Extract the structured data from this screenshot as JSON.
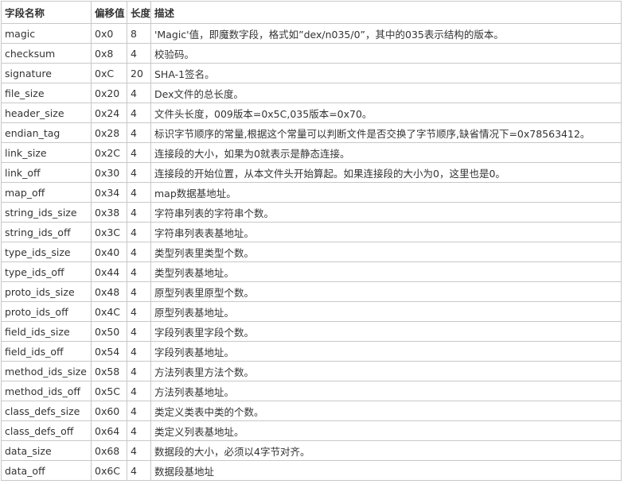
{
  "table": {
    "headers": [
      "字段名称",
      "偏移值",
      "长度",
      "描述"
    ],
    "rows": [
      [
        "magic",
        "0x0",
        "8",
        "'Magic'值，即魔数字段，格式如”dex/n035/0”，其中的035表示结构的版本。"
      ],
      [
        "checksum",
        "0x8",
        "4",
        "校验码。"
      ],
      [
        "signature",
        "0xC",
        "20",
        "SHA-1签名。"
      ],
      [
        "file_size",
        "0x20",
        "4",
        "Dex文件的总长度。"
      ],
      [
        "header_size",
        "0x24",
        "4",
        "文件头长度，009版本=0x5C,035版本=0x70。"
      ],
      [
        "endian_tag",
        "0x28",
        "4",
        "标识字节顺序的常量,根据这个常量可以判断文件是否交换了字节顺序,缺省情况下=0x78563412。"
      ],
      [
        "link_size",
        "0x2C",
        "4",
        "连接段的大小，如果为0就表示是静态连接。"
      ],
      [
        "link_off",
        "0x30",
        "4",
        "连接段的开始位置，从本文件头开始算起。如果连接段的大小为0，这里也是0。"
      ],
      [
        "map_off",
        "0x34",
        "4",
        "map数据基地址。"
      ],
      [
        "string_ids_size",
        "0x38",
        "4",
        "字符串列表的字符串个数。"
      ],
      [
        "string_ids_off",
        "0x3C",
        "4",
        "字符串列表表基地址。"
      ],
      [
        "type_ids_size",
        "0x40",
        "4",
        "类型列表里类型个数。"
      ],
      [
        "type_ids_off",
        "0x44",
        "4",
        "类型列表基地址。"
      ],
      [
        "proto_ids_size",
        "0x48",
        "4",
        "原型列表里原型个数。"
      ],
      [
        "proto_ids_off",
        "0x4C",
        "4",
        "原型列表基地址。"
      ],
      [
        "field_ids_size",
        "0x50",
        "4",
        "字段列表里字段个数。"
      ],
      [
        "field_ids_off",
        "0x54",
        "4",
        "字段列表基地址。"
      ],
      [
        "method_ids_size",
        "0x58",
        "4",
        "方法列表里方法个数。"
      ],
      [
        "method_ids_off",
        "0x5C",
        "4",
        "方法列表基地址。"
      ],
      [
        "class_defs_size",
        "0x60",
        "4",
        "类定义类表中类的个数。"
      ],
      [
        "class_defs_off",
        "0x64",
        "4",
        "类定义列表基地址。"
      ],
      [
        "data_size",
        "0x68",
        "4",
        "数据段的大小，必须以4字节对齐。"
      ],
      [
        "data_off",
        "0x6C",
        "4",
        "数据段基地址"
      ]
    ]
  }
}
